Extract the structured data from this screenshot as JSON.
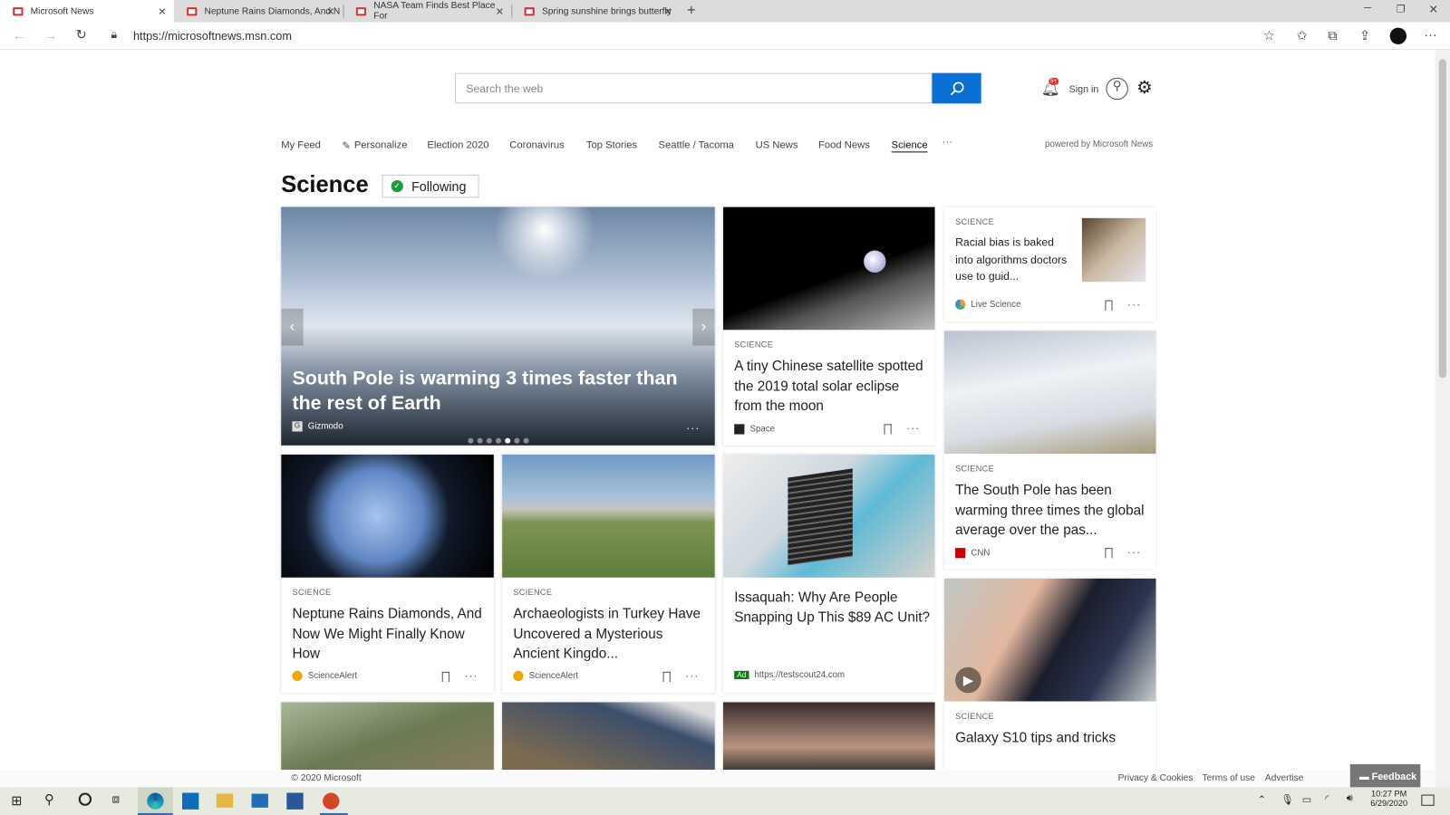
{
  "browser": {
    "tabs": [
      {
        "title": "Microsoft News",
        "active": true
      },
      {
        "title": "Neptune Rains Diamonds, And N"
      },
      {
        "title": "NASA Team Finds Best Place For"
      },
      {
        "title": "Spring sunshine brings butterfly"
      }
    ],
    "url": "https://microsoftnews.msn.com"
  },
  "header": {
    "search_placeholder": "Search the web",
    "notif_badge": "5+",
    "sign_in": "Sign in"
  },
  "nav": {
    "items": [
      "My Feed",
      "Personalize",
      "Election 2020",
      "Coronavirus",
      "Top Stories",
      "Seattle / Tacoma",
      "US News",
      "Food News",
      "Science"
    ],
    "active": "Science",
    "more": "···",
    "powered": "powered by Microsoft News"
  },
  "section": {
    "title": "Science",
    "follow": "Following"
  },
  "hero": {
    "title": "South Pole is warming 3 times faster than the rest of Earth",
    "source": "Gizmodo",
    "slides": 7,
    "active_slide": 5
  },
  "cards": [
    {
      "cat": "SCIENCE",
      "title": "A tiny Chinese satellite spotted the 2019 total solar eclipse from the moon",
      "source": "Space"
    },
    {
      "cat": "SCIENCE",
      "title": "Racial bias is baked into algorithms doctors use to guid...",
      "source": "Live Science"
    },
    {
      "cat": "SCIENCE",
      "title": "The South Pole has been warming three times the global average over the pas...",
      "source": "CNN"
    },
    {
      "cat": "SCIENCE",
      "title": "Neptune Rains Diamonds, And Now We Might Finally Know How",
      "source": "ScienceAlert"
    },
    {
      "cat": "SCIENCE",
      "title": "Archaeologists in Turkey Have Uncovered a Mysterious Ancient Kingdo...",
      "source": "ScienceAlert"
    },
    {
      "cat": "",
      "title": "Issaquah: Why Are People Snapping Up This $89 AC Unit?",
      "source": "https://testscout24.com",
      "ad": "Ad"
    },
    {
      "cat": "SCIENCE",
      "title": "Galaxy S10 tips and tricks",
      "source": ""
    }
  ],
  "footer": {
    "copyright": "© 2020 Microsoft",
    "links": [
      "Privacy & Cookies",
      "Terms of use",
      "Advertise"
    ],
    "feedback": "Feedback"
  },
  "taskbar": {
    "time": "10:27 PM",
    "date": "6/29/2020"
  }
}
